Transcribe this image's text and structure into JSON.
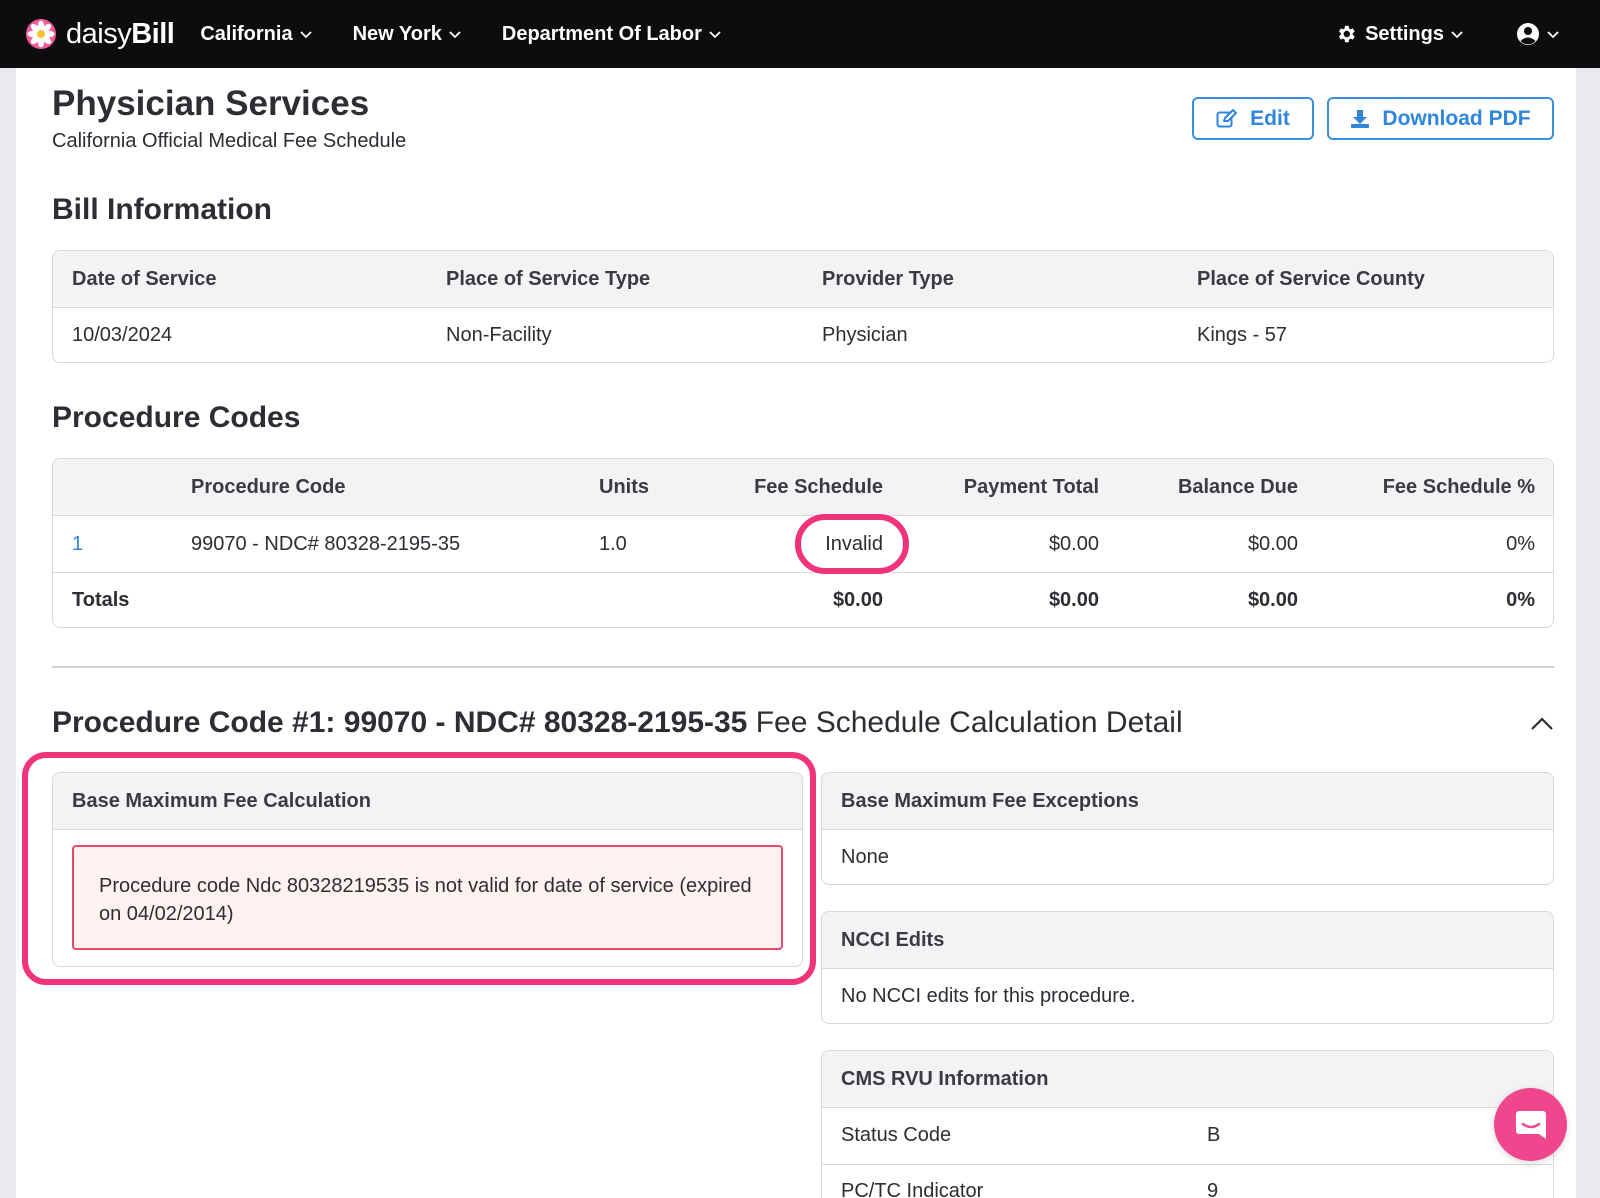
{
  "nav": {
    "logo_text_light": "daisy",
    "logo_text_bold": "Bill",
    "items": [
      {
        "label": "California"
      },
      {
        "label": "New York"
      },
      {
        "label": "Department Of Labor"
      }
    ],
    "settings_label": "Settings"
  },
  "page": {
    "title": "Physician Services",
    "subtitle": "California Official Medical Fee Schedule",
    "edit_label": "Edit",
    "download_label": "Download PDF"
  },
  "bill_info": {
    "title": "Bill Information",
    "headers": [
      "Date of Service",
      "Place of Service Type",
      "Provider Type",
      "Place of Service County"
    ],
    "values": [
      "10/03/2024",
      "Non-Facility",
      "Physician",
      "Kings - 57"
    ]
  },
  "procedure_codes": {
    "title": "Procedure Codes",
    "headers": [
      "Procedure Code",
      "Units",
      "Fee Schedule",
      "Payment Total",
      "Balance Due",
      "Fee Schedule %"
    ],
    "rows": [
      {
        "index": "1",
        "code": "99070 - NDC# 80328-2195-35",
        "units": "1.0",
        "fee_schedule": "Invalid",
        "payment_total": "$0.00",
        "balance_due": "$0.00",
        "fee_pct": "0%"
      }
    ],
    "totals": {
      "label": "Totals",
      "fee_schedule": "$0.00",
      "payment_total": "$0.00",
      "balance_due": "$0.00",
      "fee_pct": "0%"
    }
  },
  "detail": {
    "title_bold": "Procedure Code #1: 99070 - NDC# 80328-2195-35",
    "title_rest": " Fee Schedule Calculation Detail",
    "base_calc_title": "Base Maximum Fee Calculation",
    "error_message": "Procedure code Ndc 80328219535 is not valid for date of service (expired on 04/02/2014)",
    "exceptions_title": "Base Maximum Fee Exceptions",
    "exceptions_value": "None",
    "ncci_title": "NCCI Edits",
    "ncci_value": "No NCCI edits for this procedure.",
    "cms_title": "CMS RVU Information",
    "cms_rows": [
      {
        "label": "Status Code",
        "value": "B"
      },
      {
        "label": "PC/TC Indicator",
        "value": "9"
      }
    ]
  },
  "colors": {
    "accent_blue": "#2f86dc",
    "highlight_pink": "#f0337a",
    "error_border": "#e8496a",
    "nav_bg": "#0d0d0f"
  }
}
